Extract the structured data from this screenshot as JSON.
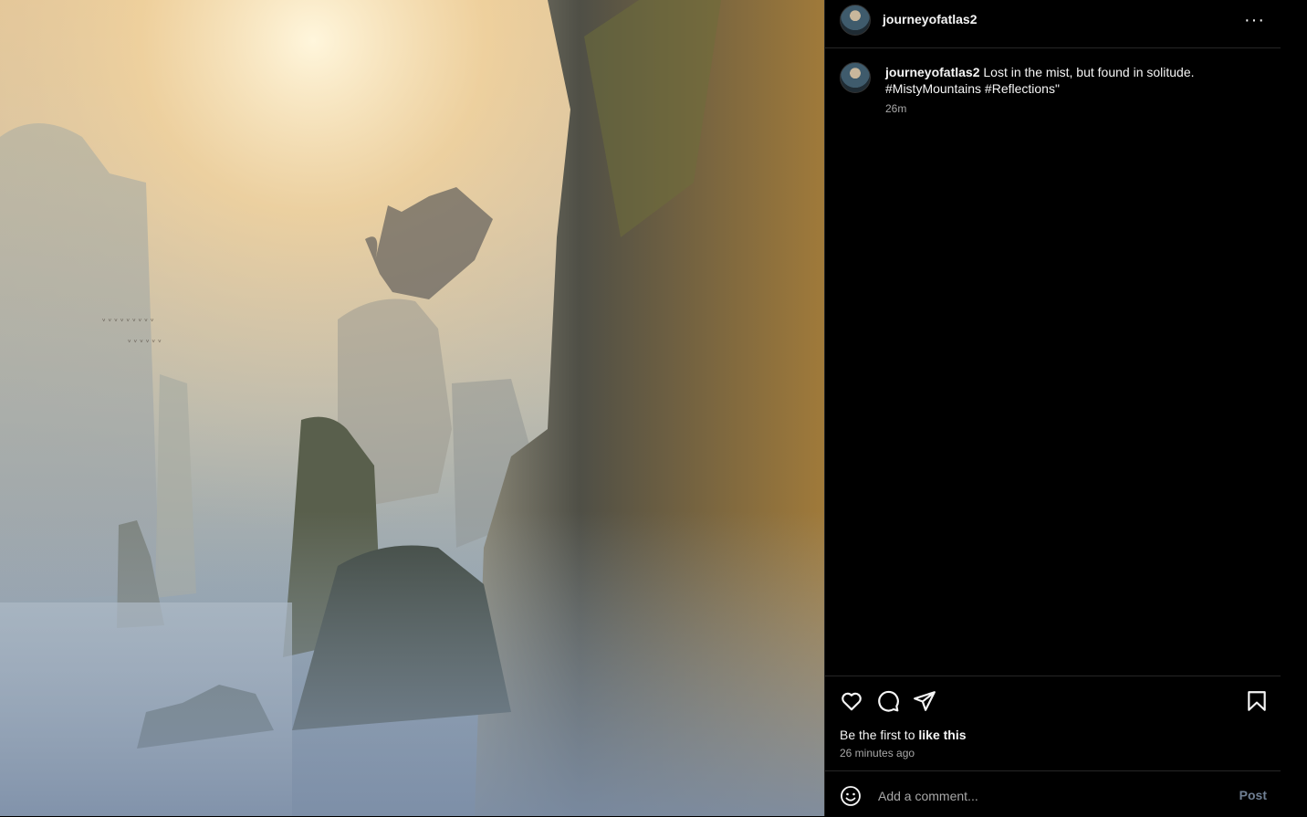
{
  "post": {
    "username": "journeyofatlas2",
    "caption": "Lost in the mist, but found in solitude. #MistyMountains #Reflections\"",
    "time_short": "26m",
    "likes_prefix": "Be the first to ",
    "likes_action": "like this",
    "time_long": "26 minutes ago",
    "more_label": "···"
  },
  "comment": {
    "placeholder": "Add a comment...",
    "post_label": "Post"
  },
  "icons": {
    "like": "heart-icon",
    "comment": "comment-icon",
    "share": "send-icon",
    "save": "bookmark-icon",
    "emoji": "emoji-icon",
    "more": "more-icon"
  }
}
